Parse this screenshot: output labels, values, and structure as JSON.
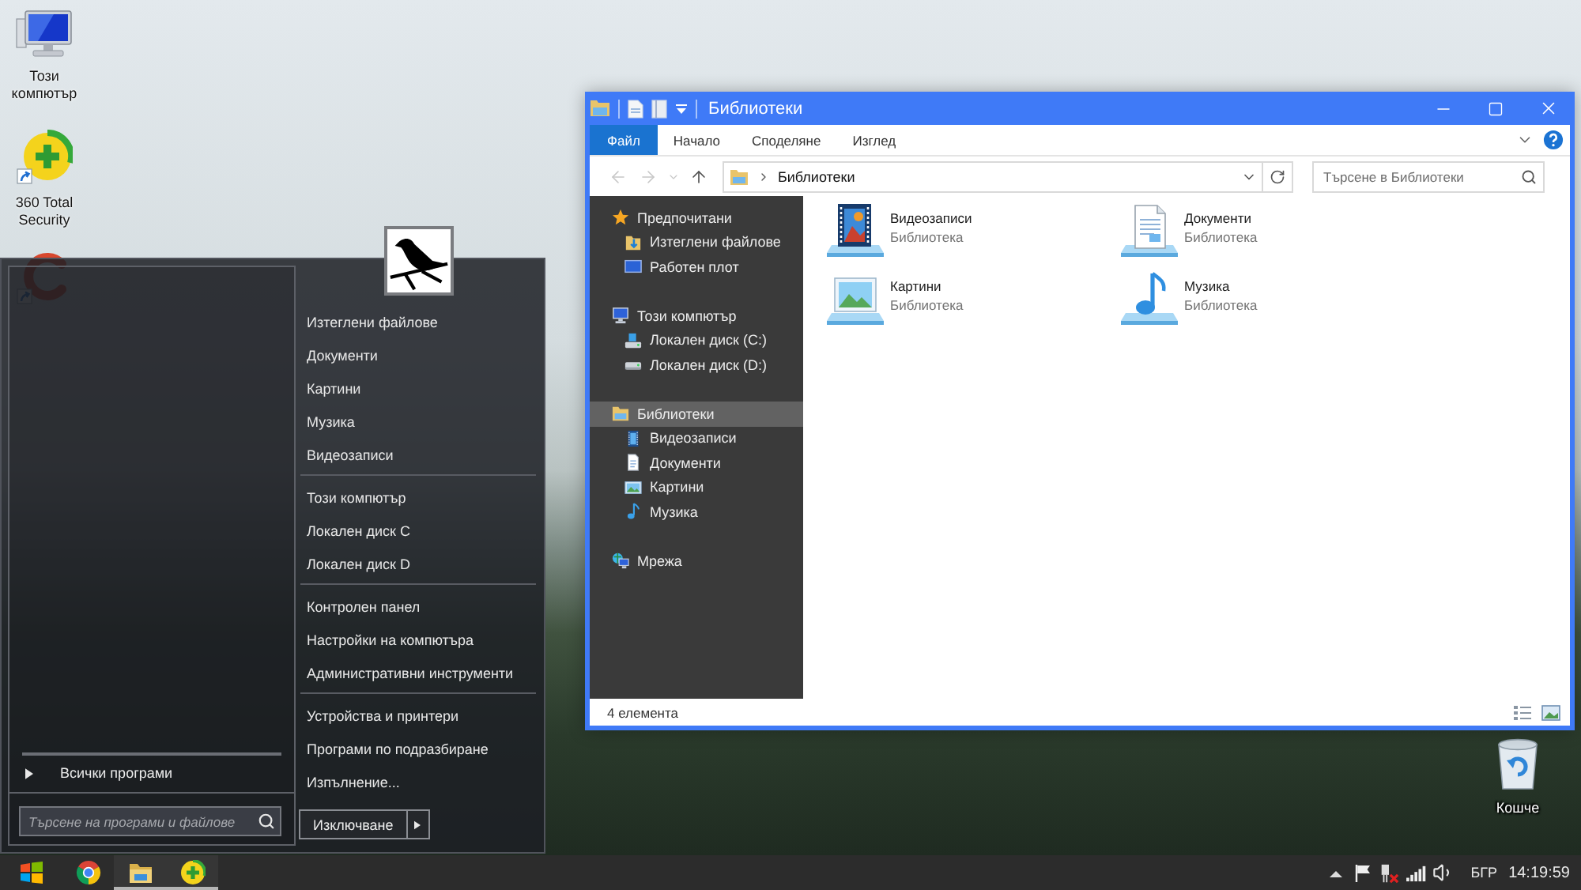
{
  "desktop": {
    "icons": [
      {
        "kind": "computer",
        "label": "Този компютър"
      },
      {
        "kind": "security",
        "label": "360 Total Security"
      },
      {
        "kind": "cleaner"
      }
    ],
    "recycle_bin": {
      "label": "Кошче"
    }
  },
  "start_menu": {
    "all_programs": "Всички програми",
    "search": {
      "placeholder": "Търсене на програми и файлове"
    },
    "groups": [
      {
        "items": [
          {
            "label": "Изтеглени файлове"
          },
          {
            "label": "Документи"
          },
          {
            "label": "Картини"
          },
          {
            "label": "Музика"
          },
          {
            "label": "Видеозаписи"
          }
        ]
      },
      {
        "items": [
          {
            "label": "Този компютър"
          },
          {
            "label": "Локален диск C"
          },
          {
            "label": "Локален диск D"
          }
        ]
      },
      {
        "items": [
          {
            "label": "Контролен панел"
          },
          {
            "label": "Настройки на компютъра"
          },
          {
            "label": "Административни инструменти"
          }
        ]
      },
      {
        "items": [
          {
            "label": "Устройства и принтери"
          },
          {
            "label": "Програми по подразбиране"
          },
          {
            "label": "Изпълнение..."
          }
        ]
      }
    ],
    "shutdown": {
      "label": "Изключване"
    }
  },
  "explorer": {
    "title": "Библиотеки",
    "ribbon_tabs": [
      {
        "label": "Файл",
        "selected": true
      },
      {
        "label": "Начало",
        "selected": false
      },
      {
        "label": "Споделяне",
        "selected": false
      },
      {
        "label": "Изглед",
        "selected": false
      }
    ],
    "nav_buttons": [
      {
        "kind": "back",
        "disabled": true
      },
      {
        "kind": "forward",
        "disabled": true
      },
      {
        "kind": "recent",
        "disabled": true
      },
      {
        "kind": "up",
        "disabled": false
      }
    ],
    "address": {
      "path": "Библиотеки"
    },
    "search": {
      "placeholder": "Търсене в Библиотеки"
    },
    "nav": [
      {
        "kind": "favorites",
        "label": "Предпочитани",
        "selected": false,
        "children": [
          {
            "kind": "downloads",
            "label": "Изтеглени файлове",
            "selected": false
          },
          {
            "kind": "desktop",
            "label": "Работен плот",
            "selected": false
          }
        ]
      },
      {
        "kind": "computer",
        "label": "Този компютър",
        "selected": false,
        "children": [
          {
            "kind": "drive-c",
            "label": "Локален диск (C:)",
            "selected": false
          },
          {
            "kind": "drive-d",
            "label": "Локален диск (D:)",
            "selected": false
          }
        ]
      },
      {
        "kind": "libraries",
        "label": "Библиотеки",
        "selected": true,
        "children": [
          {
            "kind": "videos",
            "label": "Видеозаписи",
            "selected": false
          },
          {
            "kind": "documents",
            "label": "Документи",
            "selected": false
          },
          {
            "kind": "pictures",
            "label": "Картини",
            "selected": false
          },
          {
            "kind": "music",
            "label": "Музика",
            "selected": false
          }
        ]
      },
      {
        "kind": "network",
        "label": "Мрежа",
        "selected": false
      }
    ],
    "items": [
      {
        "kind": "videos",
        "name": "Видеозаписи",
        "type": "Библиотека"
      },
      {
        "kind": "documents",
        "name": "Документи",
        "type": "Библиотека"
      },
      {
        "kind": "pictures",
        "name": "Картини",
        "type": "Библиотека"
      },
      {
        "kind": "music",
        "name": "Музика",
        "type": "Библиотека"
      }
    ],
    "status": "4 елемента"
  },
  "taskbar": {
    "apps": [
      {
        "kind": "browser",
        "running": false
      },
      {
        "kind": "folder",
        "running": true
      },
      {
        "kind": "security",
        "running": true
      }
    ],
    "language": "БГР",
    "time": "14:19:59"
  }
}
